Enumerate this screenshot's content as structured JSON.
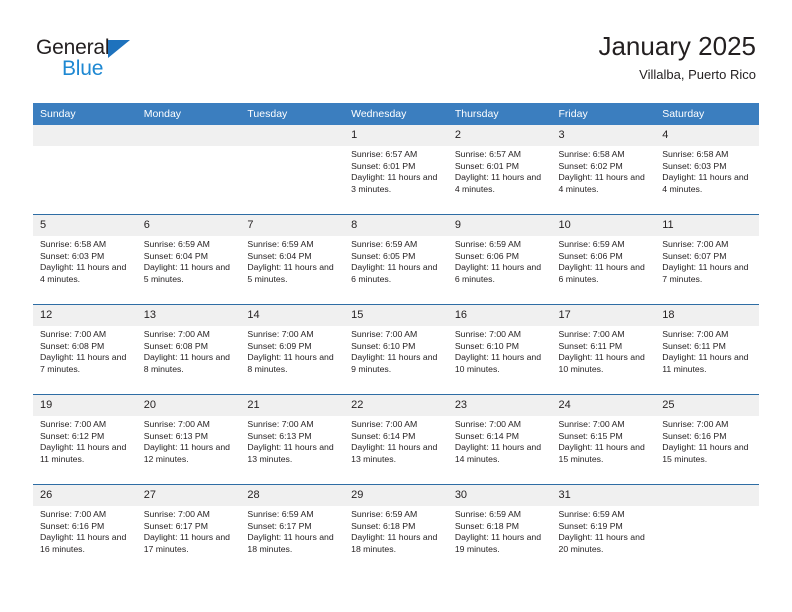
{
  "brand": {
    "name_top": "General",
    "name_bottom": "Blue",
    "accent_color": "#1e88d2",
    "triangle_color": "#1e72bd"
  },
  "header": {
    "title": "January 2025",
    "subtitle": "Villalba, Puerto Rico"
  },
  "theme": {
    "header_bg": "#3b7ebf",
    "header_text": "#ffffff",
    "daynum_bg": "#f0f0f0",
    "row_divider": "#2e6da4",
    "body_text": "#231f20"
  },
  "weekday_headers": [
    "Sunday",
    "Monday",
    "Tuesday",
    "Wednesday",
    "Thursday",
    "Friday",
    "Saturday"
  ],
  "labels": {
    "sunrise": "Sunrise:",
    "sunset": "Sunset:",
    "daylight": "Daylight:"
  },
  "weeks": [
    [
      {
        "day": "",
        "empty": true
      },
      {
        "day": "",
        "empty": true
      },
      {
        "day": "",
        "empty": true
      },
      {
        "day": "1",
        "sunrise": "Sunrise: 6:57 AM",
        "sunset": "Sunset: 6:01 PM",
        "daylight": "Daylight: 11 hours and 3 minutes."
      },
      {
        "day": "2",
        "sunrise": "Sunrise: 6:57 AM",
        "sunset": "Sunset: 6:01 PM",
        "daylight": "Daylight: 11 hours and 4 minutes."
      },
      {
        "day": "3",
        "sunrise": "Sunrise: 6:58 AM",
        "sunset": "Sunset: 6:02 PM",
        "daylight": "Daylight: 11 hours and 4 minutes."
      },
      {
        "day": "4",
        "sunrise": "Sunrise: 6:58 AM",
        "sunset": "Sunset: 6:03 PM",
        "daylight": "Daylight: 11 hours and 4 minutes."
      }
    ],
    [
      {
        "day": "5",
        "sunrise": "Sunrise: 6:58 AM",
        "sunset": "Sunset: 6:03 PM",
        "daylight": "Daylight: 11 hours and 4 minutes."
      },
      {
        "day": "6",
        "sunrise": "Sunrise: 6:59 AM",
        "sunset": "Sunset: 6:04 PM",
        "daylight": "Daylight: 11 hours and 5 minutes."
      },
      {
        "day": "7",
        "sunrise": "Sunrise: 6:59 AM",
        "sunset": "Sunset: 6:04 PM",
        "daylight": "Daylight: 11 hours and 5 minutes."
      },
      {
        "day": "8",
        "sunrise": "Sunrise: 6:59 AM",
        "sunset": "Sunset: 6:05 PM",
        "daylight": "Daylight: 11 hours and 6 minutes."
      },
      {
        "day": "9",
        "sunrise": "Sunrise: 6:59 AM",
        "sunset": "Sunset: 6:06 PM",
        "daylight": "Daylight: 11 hours and 6 minutes."
      },
      {
        "day": "10",
        "sunrise": "Sunrise: 6:59 AM",
        "sunset": "Sunset: 6:06 PM",
        "daylight": "Daylight: 11 hours and 6 minutes."
      },
      {
        "day": "11",
        "sunrise": "Sunrise: 7:00 AM",
        "sunset": "Sunset: 6:07 PM",
        "daylight": "Daylight: 11 hours and 7 minutes."
      }
    ],
    [
      {
        "day": "12",
        "sunrise": "Sunrise: 7:00 AM",
        "sunset": "Sunset: 6:08 PM",
        "daylight": "Daylight: 11 hours and 7 minutes."
      },
      {
        "day": "13",
        "sunrise": "Sunrise: 7:00 AM",
        "sunset": "Sunset: 6:08 PM",
        "daylight": "Daylight: 11 hours and 8 minutes."
      },
      {
        "day": "14",
        "sunrise": "Sunrise: 7:00 AM",
        "sunset": "Sunset: 6:09 PM",
        "daylight": "Daylight: 11 hours and 8 minutes."
      },
      {
        "day": "15",
        "sunrise": "Sunrise: 7:00 AM",
        "sunset": "Sunset: 6:10 PM",
        "daylight": "Daylight: 11 hours and 9 minutes."
      },
      {
        "day": "16",
        "sunrise": "Sunrise: 7:00 AM",
        "sunset": "Sunset: 6:10 PM",
        "daylight": "Daylight: 11 hours and 10 minutes."
      },
      {
        "day": "17",
        "sunrise": "Sunrise: 7:00 AM",
        "sunset": "Sunset: 6:11 PM",
        "daylight": "Daylight: 11 hours and 10 minutes."
      },
      {
        "day": "18",
        "sunrise": "Sunrise: 7:00 AM",
        "sunset": "Sunset: 6:11 PM",
        "daylight": "Daylight: 11 hours and 11 minutes."
      }
    ],
    [
      {
        "day": "19",
        "sunrise": "Sunrise: 7:00 AM",
        "sunset": "Sunset: 6:12 PM",
        "daylight": "Daylight: 11 hours and 11 minutes."
      },
      {
        "day": "20",
        "sunrise": "Sunrise: 7:00 AM",
        "sunset": "Sunset: 6:13 PM",
        "daylight": "Daylight: 11 hours and 12 minutes."
      },
      {
        "day": "21",
        "sunrise": "Sunrise: 7:00 AM",
        "sunset": "Sunset: 6:13 PM",
        "daylight": "Daylight: 11 hours and 13 minutes."
      },
      {
        "day": "22",
        "sunrise": "Sunrise: 7:00 AM",
        "sunset": "Sunset: 6:14 PM",
        "daylight": "Daylight: 11 hours and 13 minutes."
      },
      {
        "day": "23",
        "sunrise": "Sunrise: 7:00 AM",
        "sunset": "Sunset: 6:14 PM",
        "daylight": "Daylight: 11 hours and 14 minutes."
      },
      {
        "day": "24",
        "sunrise": "Sunrise: 7:00 AM",
        "sunset": "Sunset: 6:15 PM",
        "daylight": "Daylight: 11 hours and 15 minutes."
      },
      {
        "day": "25",
        "sunrise": "Sunrise: 7:00 AM",
        "sunset": "Sunset: 6:16 PM",
        "daylight": "Daylight: 11 hours and 15 minutes."
      }
    ],
    [
      {
        "day": "26",
        "sunrise": "Sunrise: 7:00 AM",
        "sunset": "Sunset: 6:16 PM",
        "daylight": "Daylight: 11 hours and 16 minutes."
      },
      {
        "day": "27",
        "sunrise": "Sunrise: 7:00 AM",
        "sunset": "Sunset: 6:17 PM",
        "daylight": "Daylight: 11 hours and 17 minutes."
      },
      {
        "day": "28",
        "sunrise": "Sunrise: 6:59 AM",
        "sunset": "Sunset: 6:17 PM",
        "daylight": "Daylight: 11 hours and 18 minutes."
      },
      {
        "day": "29",
        "sunrise": "Sunrise: 6:59 AM",
        "sunset": "Sunset: 6:18 PM",
        "daylight": "Daylight: 11 hours and 18 minutes."
      },
      {
        "day": "30",
        "sunrise": "Sunrise: 6:59 AM",
        "sunset": "Sunset: 6:18 PM",
        "daylight": "Daylight: 11 hours and 19 minutes."
      },
      {
        "day": "31",
        "sunrise": "Sunrise: 6:59 AM",
        "sunset": "Sunset: 6:19 PM",
        "daylight": "Daylight: 11 hours and 20 minutes."
      },
      {
        "day": "",
        "empty": true
      }
    ]
  ]
}
